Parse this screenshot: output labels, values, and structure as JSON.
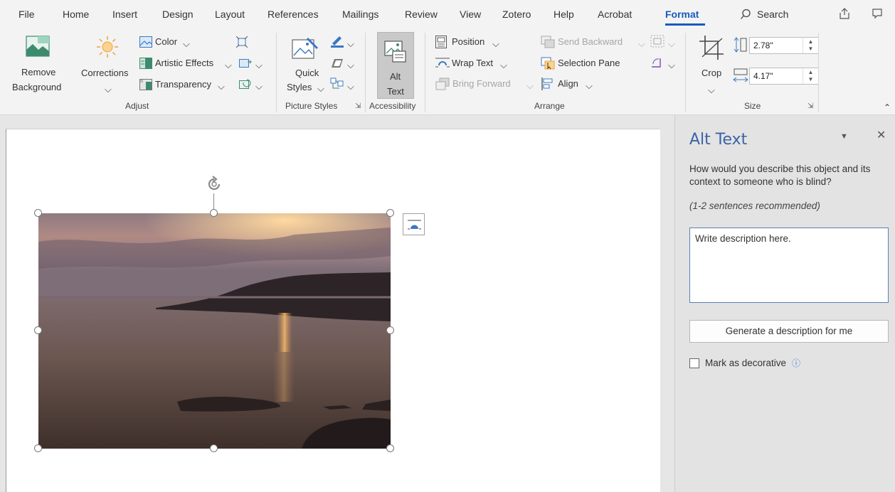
{
  "menu": {
    "items": [
      "File",
      "Home",
      "Insert",
      "Design",
      "Layout",
      "References",
      "Mailings",
      "Review",
      "View",
      "Zotero",
      "Help",
      "Acrobat",
      "Format"
    ],
    "active": "Format",
    "search_label": "Search"
  },
  "ribbon": {
    "adjust": {
      "remove_bg_line1": "Remove",
      "remove_bg_line2": "Background",
      "corrections": "Corrections",
      "color": "Color",
      "artistic_effects": "Artistic Effects",
      "transparency": "Transparency",
      "group_label": "Adjust"
    },
    "picture_styles": {
      "quick_line1": "Quick",
      "quick_line2": "Styles",
      "group_label": "Picture Styles"
    },
    "accessibility": {
      "alt_line1": "Alt",
      "alt_line2": "Text",
      "group_label": "Accessibility"
    },
    "arrange": {
      "position": "Position",
      "wrap_text": "Wrap Text",
      "bring_forward": "Bring Forward",
      "send_backward": "Send Backward",
      "selection_pane": "Selection Pane",
      "align": "Align",
      "group_label": "Arrange"
    },
    "size": {
      "crop": "Crop",
      "height": "2.78\"",
      "width": "4.17\"",
      "group_label": "Size"
    }
  },
  "alt_text_pane": {
    "title": "Alt Text",
    "question": "How would you describe this object and its context to someone who is blind?",
    "recommendation": "(1-2 sentences recommended)",
    "textarea_value": "Write description here.",
    "generate_button": "Generate a description for me",
    "decorative_label": "Mark as decorative"
  },
  "colors": {
    "accent": "#185abd",
    "pane_title": "#3a64a5",
    "ribbon_bg": "#f3f3f3",
    "pane_bg": "#e3e3e3"
  }
}
